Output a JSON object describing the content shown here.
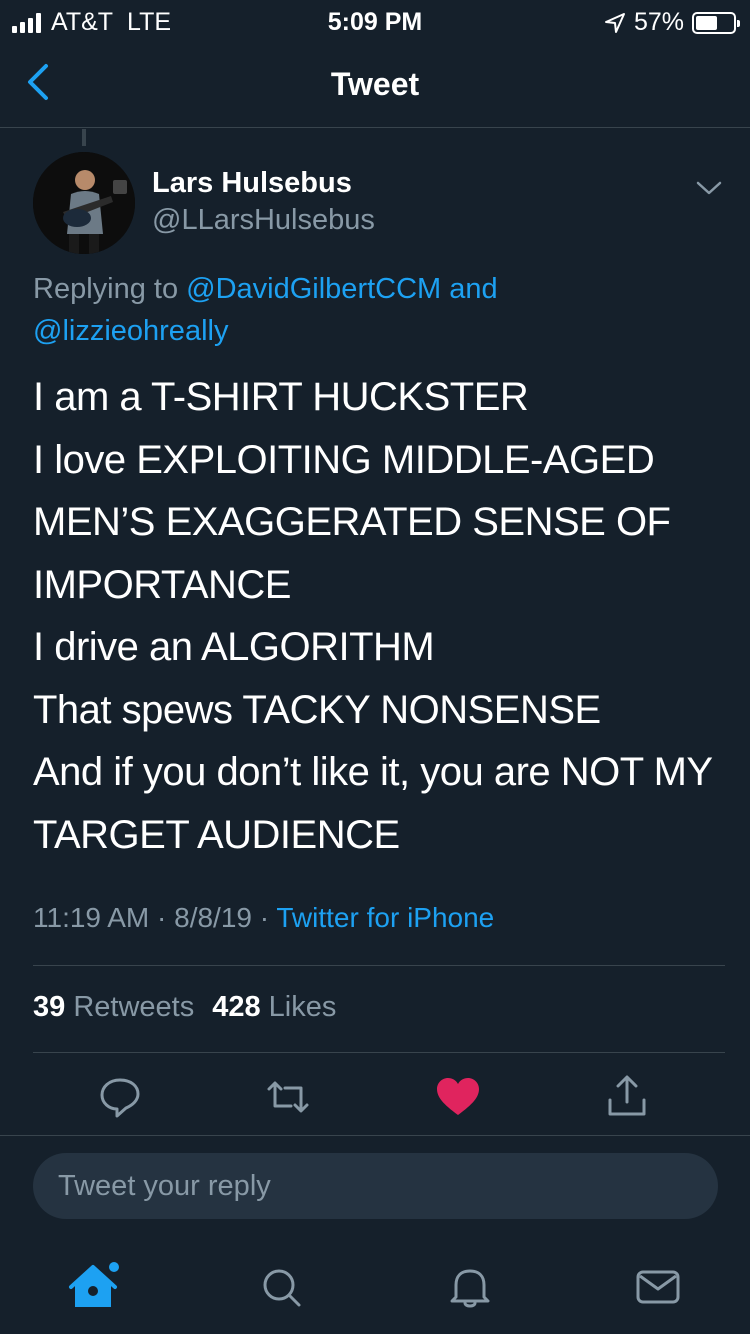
{
  "status_bar": {
    "carrier": "AT&T",
    "network": "LTE",
    "time": "5:09 PM",
    "battery_text": "57%",
    "battery_level": 0.57
  },
  "nav": {
    "title": "Tweet"
  },
  "tweet": {
    "author_name": "Lars Hulsebus",
    "author_handle": "@LLarsHulsebus",
    "replying_prefix": "Replying to",
    "reply_to_1": "@DavidGilbertCCM",
    "reply_joiner": "and",
    "reply_to_2": "@lizzieohreally",
    "text": "I am a T-SHIRT HUCKSTER\nI love EXPLOITING MIDDLE-AGED MEN’S EXAGGERATED SENSE OF IMPORTANCE\nI drive an ALGORITHM\nThat spews TACKY NONSENSE\nAnd if you don’t like it, you are NOT MY TARGET AUDIENCE",
    "time": "11:19 AM",
    "date": "8/8/19",
    "separator": "·",
    "source": "Twitter for iPhone",
    "retweet_count": "39",
    "retweet_label": "Retweets",
    "like_count": "428",
    "like_label": "Likes",
    "liked": true
  },
  "reply": {
    "placeholder": "Tweet your reply"
  },
  "tabs": [
    {
      "icon": "home-icon",
      "active": true
    },
    {
      "icon": "search-icon"
    },
    {
      "icon": "bell-icon"
    },
    {
      "icon": "mail-icon"
    }
  ],
  "colors": {
    "background": "#15202b",
    "accent": "#1da1f2",
    "muted": "#8899a6",
    "like": "#e0245e",
    "divider": "#38444d"
  }
}
